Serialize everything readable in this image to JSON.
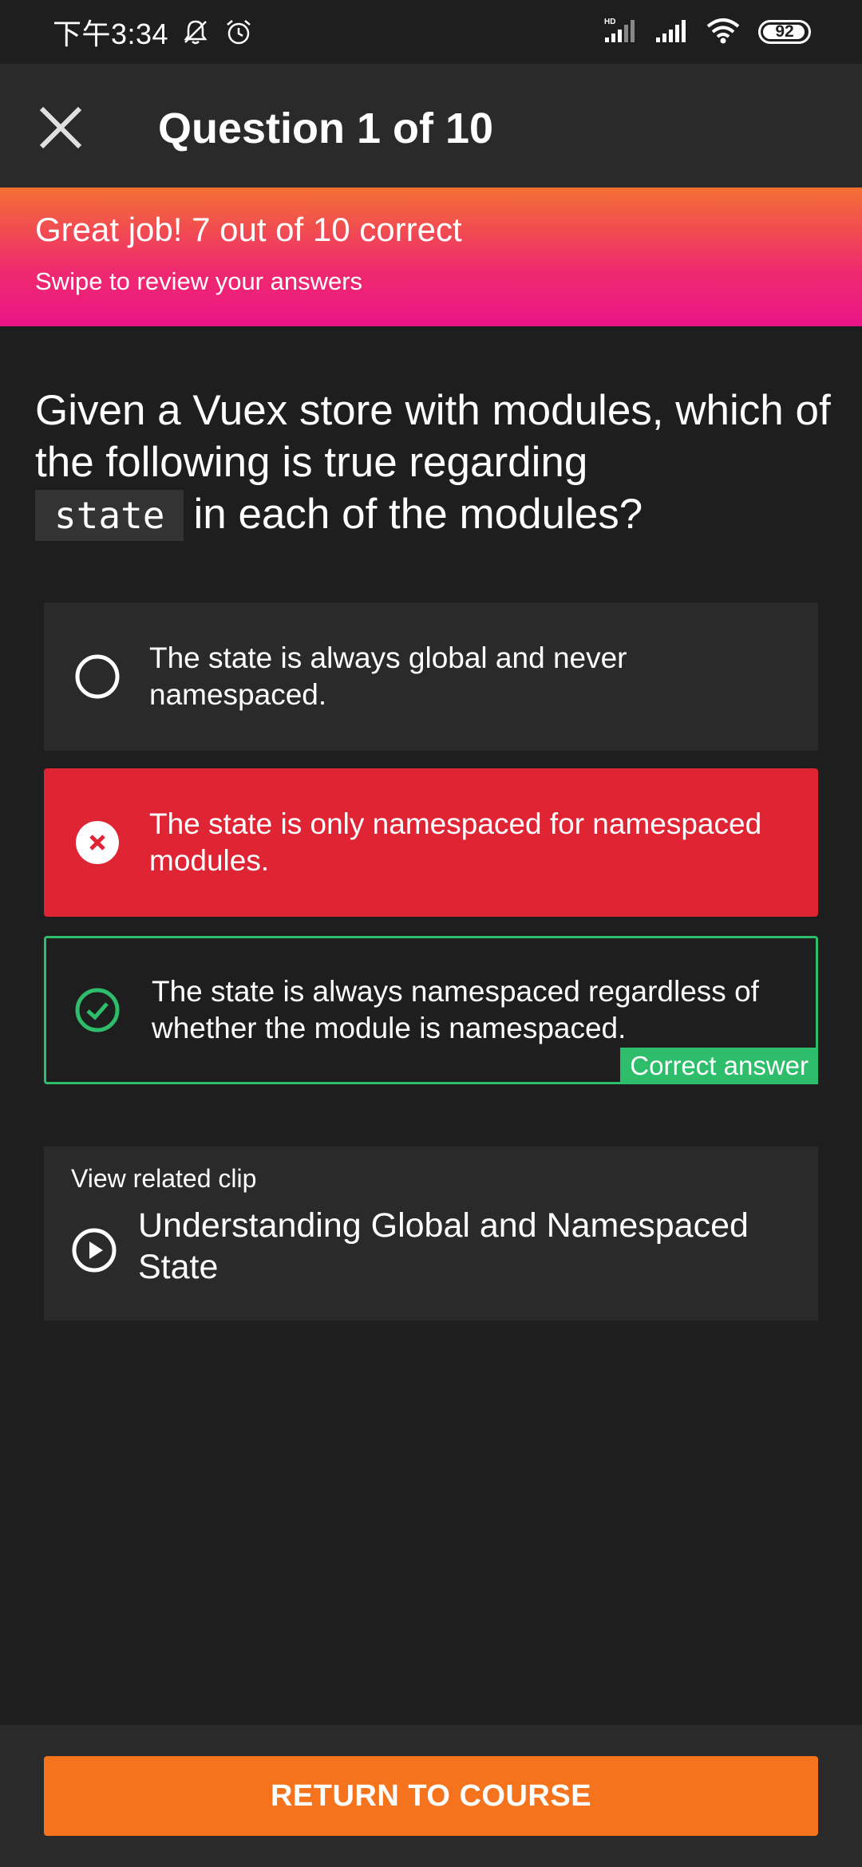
{
  "status_bar": {
    "time": "下午3:34",
    "battery": "92",
    "icons": [
      "bell-off-icon",
      "alarm-icon",
      "hd-signal-icon",
      "signal-icon",
      "wifi-icon",
      "battery-icon"
    ]
  },
  "header": {
    "title": "Question 1 of 10",
    "close_icon": "close-icon"
  },
  "banner": {
    "title": "Great job! 7 out of 10 correct",
    "subtitle": "Swipe to review your answers"
  },
  "question": {
    "before": "Given a Vuex store with modules, which of the following is true regarding",
    "code": "state",
    "after": "in each of the modules?"
  },
  "options": [
    {
      "text": "The state is always global and never namespaced.",
      "status": "unselected",
      "icon": "radio-empty-icon"
    },
    {
      "text": "The state is only namespaced for namespaced modules.",
      "status": "incorrect",
      "icon": "x-circle-icon"
    },
    {
      "text": "The state is always namespaced regardless of whether the module is namespaced.",
      "status": "correct",
      "icon": "check-circle-icon",
      "tag": "Correct answer"
    }
  ],
  "clip": {
    "label": "View related clip",
    "title": "Understanding Global and Namespaced State",
    "icon": "play-circle-icon"
  },
  "footer": {
    "button_label": "RETURN TO COURSE"
  },
  "colors": {
    "background": "#1e1e1e",
    "surface": "#2a2a2a",
    "incorrect": "#df2433",
    "correct": "#2ebd6b",
    "accent": "#f5731d",
    "banner_top": "#f37033",
    "banner_bottom": "#ea1587"
  }
}
